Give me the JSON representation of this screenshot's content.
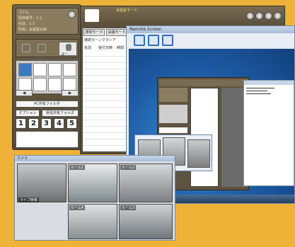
{
  "left_panel": {
    "lines": [
      "ゴテム",
      "招待番号：1-2",
      "名前：1-2",
      "所属：会議室太郎"
    ],
    "button_label": "ヨー",
    "pc_folder_button": "PC共有フォルダ",
    "option_button": "オプション",
    "receive_folder_button": "受信共有フォルダ",
    "numbers": [
      "1",
      "2",
      "3",
      "4",
      "5"
    ],
    "nav_left": "◀",
    "nav_right": "▶"
  },
  "center_window": {
    "title": "会議室モード",
    "tabs": [
      "通常モード",
      "会議モード"
    ],
    "list_header": "接続ターンクラシア",
    "columns": [
      "名前",
      "受付日時",
      "時間"
    ]
  },
  "remote_window": {
    "title": "Remote Screen"
  },
  "camera_window": {
    "title": "カメラ",
    "labels": [
      "ルーム1",
      "ルーム2",
      "ルーム3",
      "ルーム4",
      "ライブ映像"
    ]
  },
  "colors": {
    "frame": "#efb238",
    "brown": "#5e5340",
    "blue": "#1d5aa3"
  }
}
